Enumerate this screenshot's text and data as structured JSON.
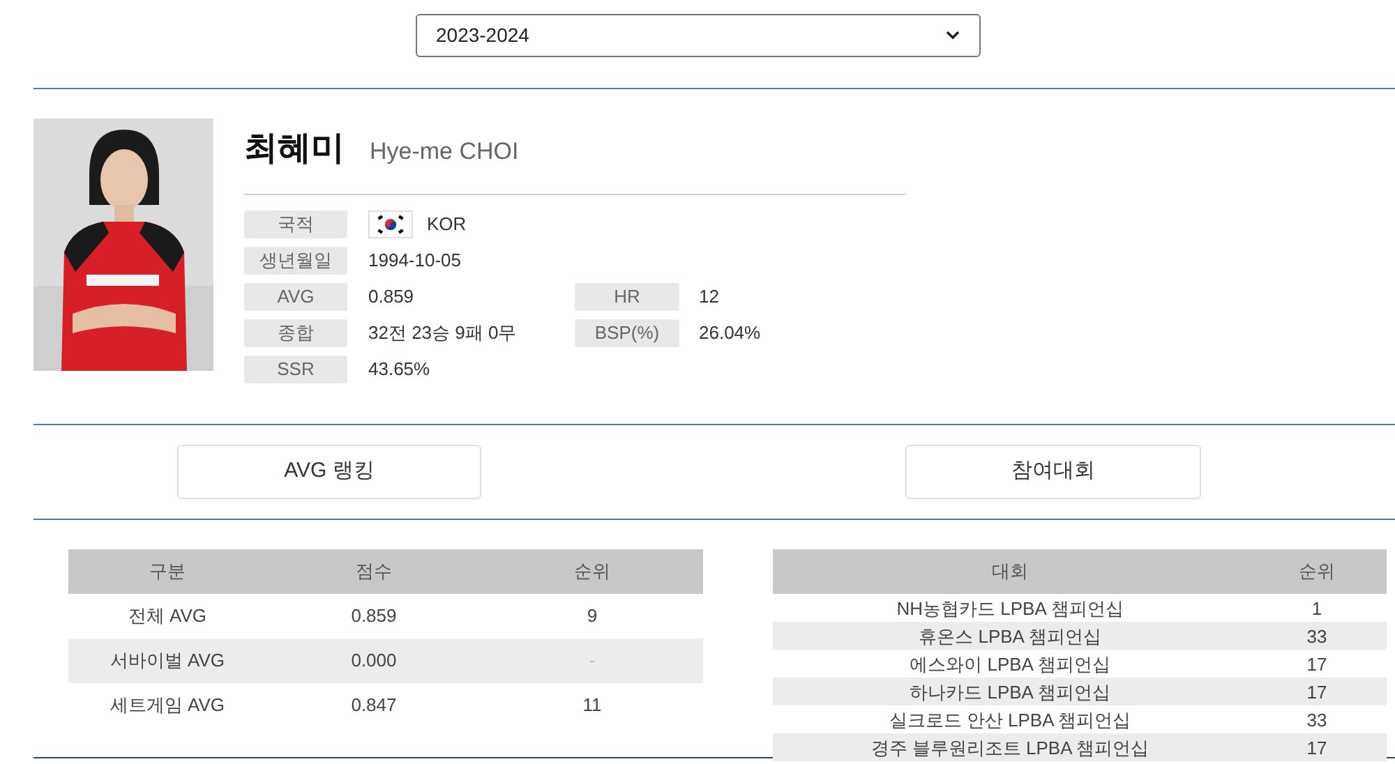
{
  "season_select": {
    "value": "2023-2024"
  },
  "player": {
    "name_ko": "최혜미",
    "name_en": "Hye-me CHOI",
    "info": [
      {
        "label": "국적",
        "value": "KOR",
        "kind": "flag"
      },
      {
        "label": "생년월일",
        "value": "1994-10-05"
      },
      {
        "label": "AVG",
        "value": "0.859",
        "side": {
          "label": "HR",
          "value": "12"
        }
      },
      {
        "label": "종합",
        "value": "32전 23승 9패 0무",
        "side": {
          "label": "BSP(%)",
          "value": "26.04%"
        }
      },
      {
        "label": "SSR",
        "value": "43.65%"
      }
    ]
  },
  "section_buttons": [
    "AVG 랭킹",
    "참여대회"
  ],
  "avg_table": {
    "columns": [
      "구분",
      "점수",
      "순위"
    ],
    "rows": [
      [
        "전체 AVG",
        "0.859",
        "9"
      ],
      [
        "서바이벌 AVG",
        "0.000",
        "-"
      ],
      [
        "세트게임 AVG",
        "0.847",
        "11"
      ]
    ]
  },
  "events_table": {
    "columns": [
      "대회",
      "순위"
    ],
    "rows": [
      [
        "NH농협카드 LPBA 챔피언십",
        "1"
      ],
      [
        "휴온스 LPBA 챔피언십",
        "33"
      ],
      [
        "에스와이 LPBA 챔피언십",
        "17"
      ],
      [
        "하나카드 LPBA 챔피언십",
        "17"
      ],
      [
        "실크로드 안산 LPBA 챔피언십",
        "33"
      ],
      [
        "경주 블루원리조트 LPBA 챔피언십",
        "17"
      ]
    ]
  }
}
